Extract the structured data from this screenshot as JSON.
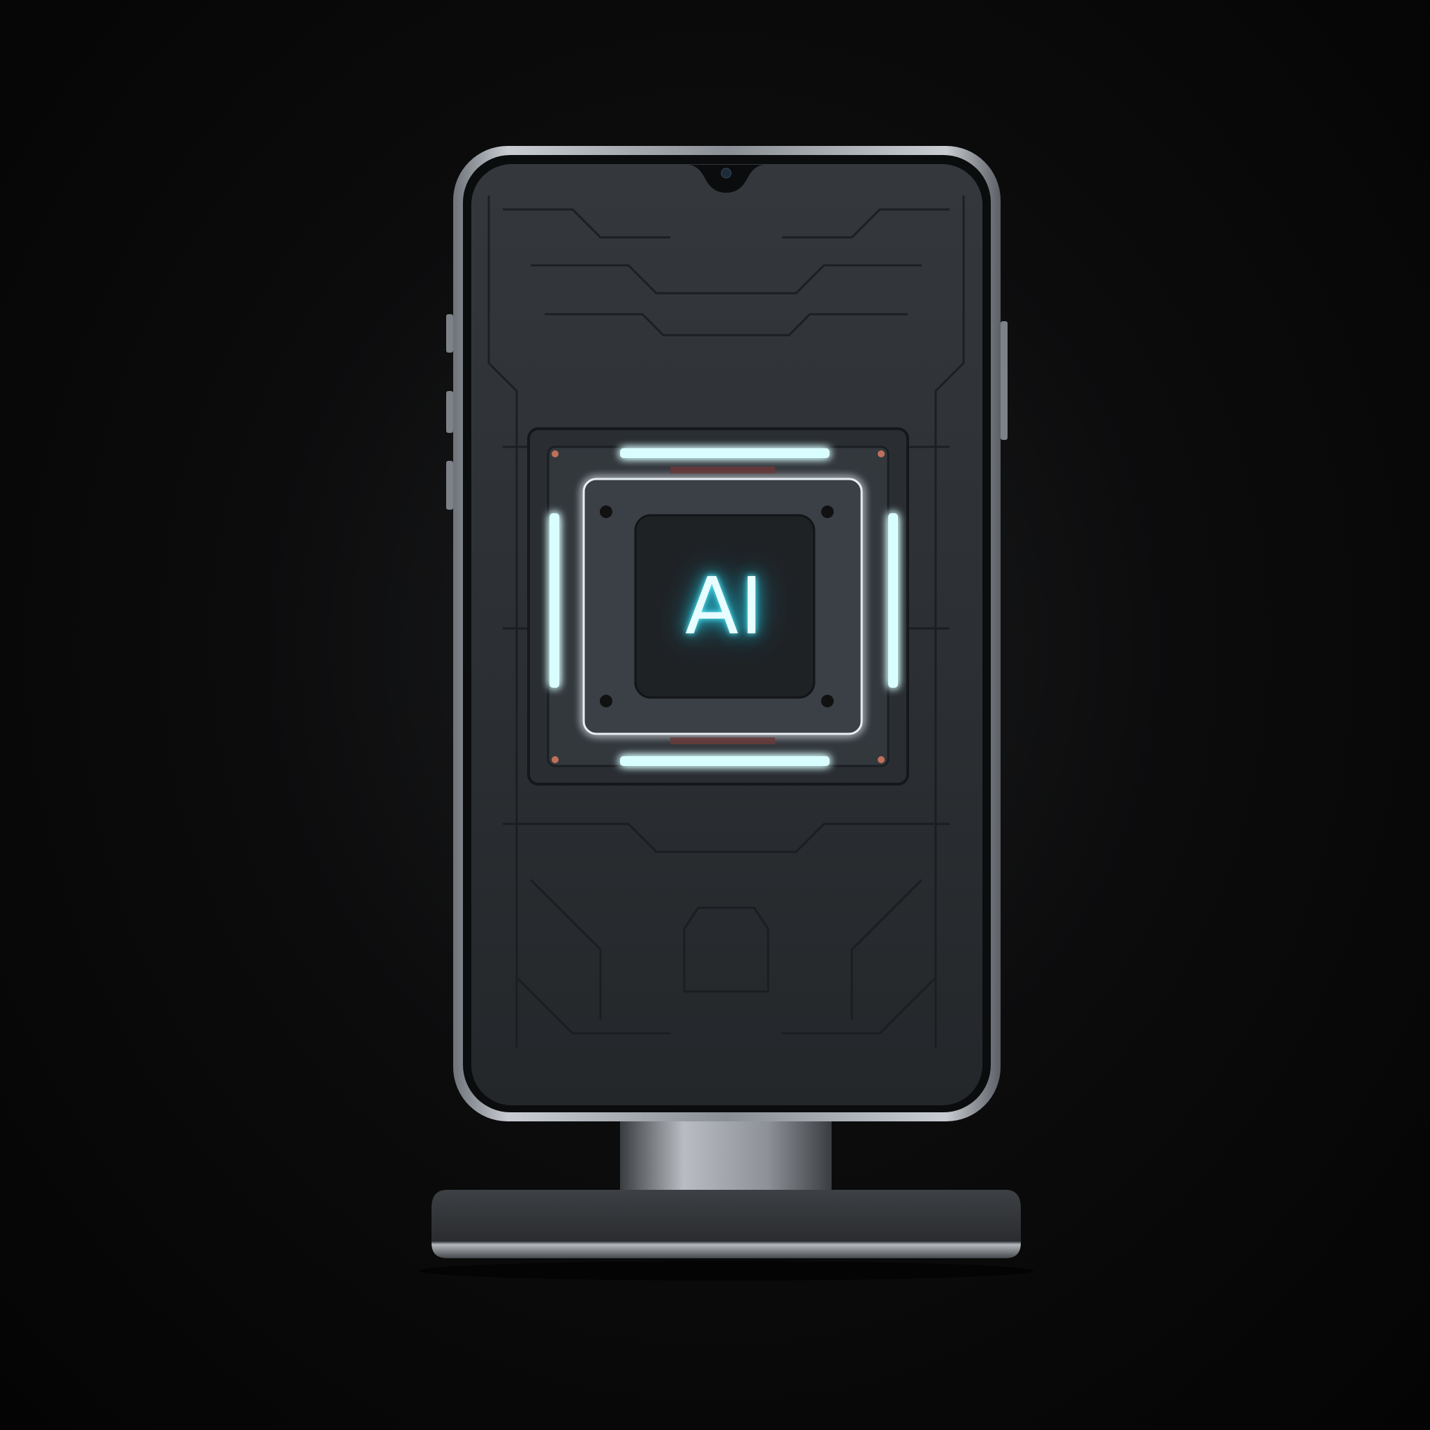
{
  "scene": {
    "chip_label": "AI",
    "colors": {
      "background": "#050505",
      "phone_frame": "#9aa0a6",
      "screen": "#2b2f33",
      "glow": "#4ff0ff",
      "accent_copper": "#c0705a"
    }
  }
}
